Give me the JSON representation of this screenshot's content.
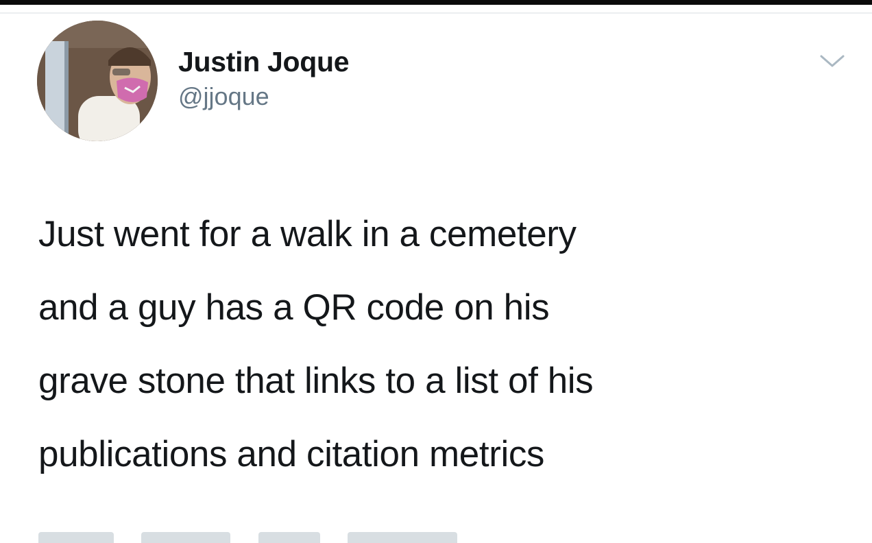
{
  "tweet": {
    "author": {
      "display_name": "Justin Joque",
      "handle": "@jjoque",
      "avatar_icon": "profile-photo"
    },
    "menu_icon": "chevron-down-icon",
    "text_lines": [
      "Just went for a walk in a cemetery",
      "and a guy has a QR code on his",
      "grave stone that links to a list of his",
      "publications and citation metrics"
    ]
  },
  "colors": {
    "text_primary": "#14171a",
    "text_secondary": "#657786",
    "background": "#ffffff",
    "chevron": "#aab8c2"
  }
}
